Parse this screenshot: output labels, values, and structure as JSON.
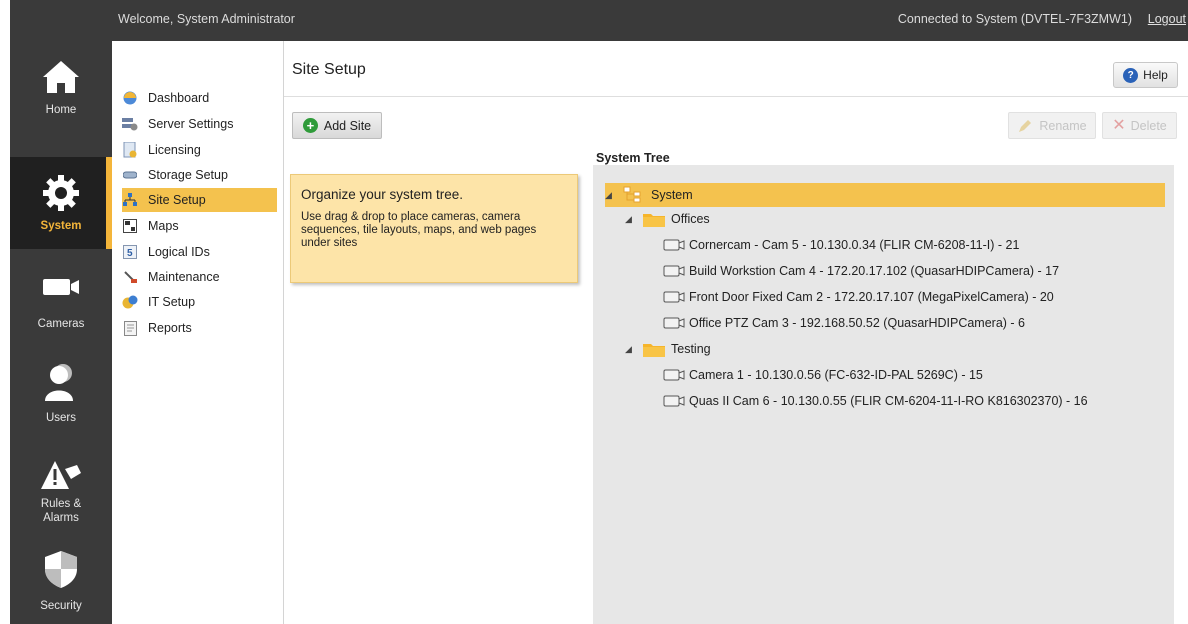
{
  "topbar": {
    "welcome": "Welcome, System Administrator",
    "connected": "Connected to System (DVTEL-7F3ZMW1)",
    "logout": "Logout"
  },
  "nav": {
    "items": [
      {
        "label": "Home",
        "icon": "home-icon",
        "active": false
      },
      {
        "label": "System",
        "icon": "gear-icon",
        "active": true
      },
      {
        "label": "Cameras",
        "icon": "camera-icon",
        "active": false
      },
      {
        "label": "Users",
        "icon": "user-icon",
        "active": false
      },
      {
        "label": "Rules &\nAlarms",
        "icon": "alarm-icon",
        "active": false
      },
      {
        "label": "Security",
        "icon": "shield-icon",
        "active": false
      }
    ]
  },
  "subnav": {
    "items": [
      {
        "label": "Dashboard",
        "icon": "dashboard-icon"
      },
      {
        "label": "Server Settings",
        "icon": "server-settings-icon"
      },
      {
        "label": "Licensing",
        "icon": "licensing-icon"
      },
      {
        "label": "Storage Setup",
        "icon": "storage-icon"
      },
      {
        "label": "Site Setup",
        "icon": "site-tree-icon",
        "active": true
      },
      {
        "label": "Maps",
        "icon": "map-icon"
      },
      {
        "label": "Logical IDs",
        "icon": "logical-id-icon"
      },
      {
        "label": "Maintenance",
        "icon": "maintenance-icon"
      },
      {
        "label": "IT Setup",
        "icon": "it-setup-icon"
      },
      {
        "label": "Reports",
        "icon": "reports-icon"
      }
    ]
  },
  "main": {
    "title": "Site Setup",
    "help_label": "Help",
    "add_site_label": "Add Site",
    "rename_label": "Rename",
    "delete_label": "Delete",
    "info": {
      "heading": "Organize your system tree.",
      "body": "Use drag & drop to place cameras, camera sequences, tile layouts, maps, and web pages under sites"
    },
    "tree_label": "System Tree",
    "tree": {
      "root": "System",
      "folders": [
        {
          "name": "Offices",
          "cameras": [
            "Cornercam - Cam 5 - 10.130.0.34 (FLIR CM-6208-11-I) - 21",
            "Build Workstion Cam 4 - 172.20.17.102 (QuasarHDIPCamera) - 17",
            "Front Door Fixed Cam 2 - 172.20.17.107 (MegaPixelCamera) - 20",
            "Office PTZ Cam 3 - 192.168.50.52 (QuasarHDIPCamera) - 6"
          ]
        },
        {
          "name": "Testing",
          "cameras": [
            "Camera 1 - 10.130.0.56 (FC-632-ID-PAL 5269C) - 15",
            "Quas II Cam 6 - 10.130.0.55 (FLIR CM-6204-11-I-RO K816302370) - 16"
          ]
        }
      ]
    }
  },
  "colors": {
    "accent": "#f4c24e",
    "rail": "#3a3a3a",
    "info_bg": "#fde4a8"
  }
}
